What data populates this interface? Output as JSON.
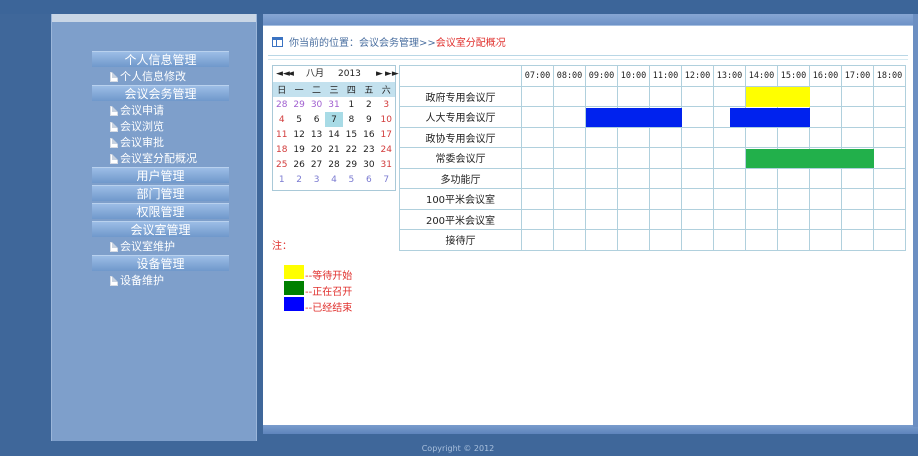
{
  "sidebar": {
    "sections": [
      {
        "title": "个人信息管理",
        "items": [
          "个人信息修改"
        ]
      },
      {
        "title": "会议会务管理",
        "items": [
          "会议申请",
          "会议浏览",
          "会议审批",
          "会议室分配概况"
        ]
      },
      {
        "title": "用户管理",
        "items": []
      },
      {
        "title": "部门管理",
        "items": []
      },
      {
        "title": "权限管理",
        "items": []
      },
      {
        "title": "会议室管理",
        "items": [
          "会议室维护"
        ]
      },
      {
        "title": "设备管理",
        "items": [
          "设备维护"
        ]
      }
    ]
  },
  "breadcrumb": {
    "prefix": "你当前的位置：",
    "parent": "会议会务管理",
    "separator": ">>",
    "current": "会议室分配概况"
  },
  "calendar": {
    "prev_year": "◄◄",
    "prev_month": "◄",
    "month": "八月",
    "year": "2013",
    "next_month": "►",
    "next_year": "►►",
    "weekdays": [
      "日",
      "一",
      "二",
      "三",
      "四",
      "五",
      "六"
    ],
    "weeks": [
      [
        "28",
        "29",
        "30",
        "31",
        "1",
        "2",
        "3"
      ],
      [
        "4",
        "5",
        "6",
        "7",
        "8",
        "9",
        "10"
      ],
      [
        "11",
        "12",
        "13",
        "14",
        "15",
        "16",
        "17"
      ],
      [
        "18",
        "19",
        "20",
        "21",
        "22",
        "23",
        "24"
      ],
      [
        "25",
        "26",
        "27",
        "28",
        "29",
        "30",
        "31"
      ],
      [
        "1",
        "2",
        "3",
        "4",
        "5",
        "6",
        "7"
      ]
    ],
    "selected": "7"
  },
  "schedule": {
    "times": [
      "07:00",
      "08:00",
      "09:00",
      "10:00",
      "11:00",
      "12:00",
      "13:00",
      "14:00",
      "15:00",
      "16:00",
      "17:00",
      "18:00"
    ],
    "rooms": [
      "政府专用会议厅",
      "人大专用会议厅",
      "政协专用会议厅",
      "常委会议厅",
      "多功能厅",
      "100平米会议室",
      "200平米会议室",
      "接待厅"
    ],
    "bookings": [
      {
        "room": 0,
        "start": "14:00",
        "end": "16:00",
        "color": "#ffff00"
      },
      {
        "room": 1,
        "start": "09:00",
        "end": "12:00",
        "color": "#0022ee"
      },
      {
        "room": 1,
        "start": "13:30",
        "end": "16:00",
        "color": "#0022ee"
      },
      {
        "room": 3,
        "start": "14:00",
        "end": "18:00",
        "color": "#22b04b"
      }
    ]
  },
  "legend": {
    "note": "注：",
    "items": [
      {
        "color": "#ffff00",
        "label": "--等待开始"
      },
      {
        "color": "#008000",
        "label": "--正在召开"
      },
      {
        "color": "#0000ff",
        "label": "--已经结束"
      }
    ]
  },
  "footer": {
    "copyright": "Copyright © 2012"
  }
}
